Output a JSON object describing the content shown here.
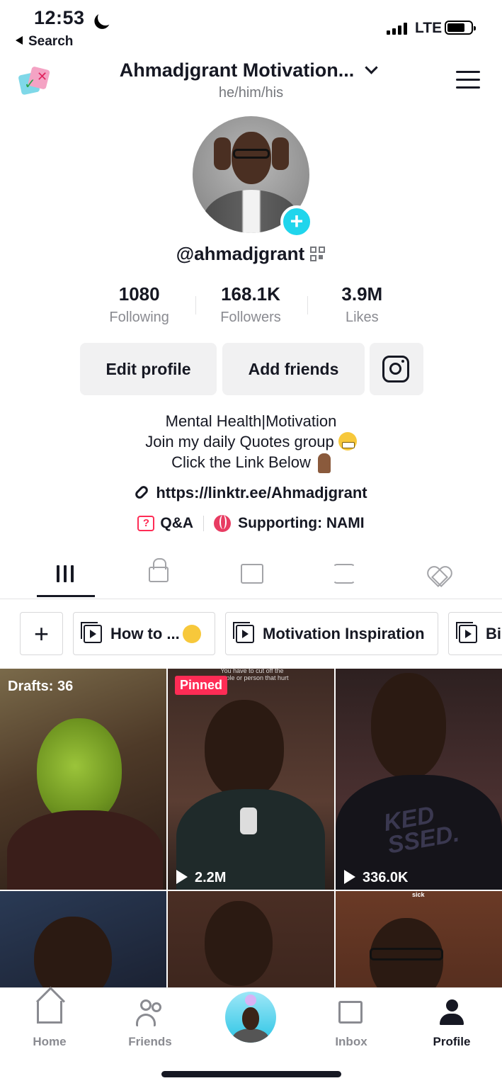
{
  "status": {
    "time": "12:53",
    "back_label": "Search",
    "network": "LTE",
    "battery_level": 0.75
  },
  "header": {
    "title": "Ahmadjgrant Motivation...",
    "pronouns": "he/him/his"
  },
  "profile": {
    "username": "@ahmadjgrant",
    "stats": [
      {
        "value": "1080",
        "label": "Following"
      },
      {
        "value": "168.1K",
        "label": "Followers"
      },
      {
        "value": "3.9M",
        "label": "Likes"
      }
    ],
    "buttons": {
      "edit": "Edit profile",
      "add_friends": "Add friends"
    },
    "bio": {
      "line1": "Mental Health|Motivation",
      "line2": "Join my daily Quotes group",
      "line3": "Click the Link Below"
    },
    "link": "https://linktr.ee/Ahmadjgrant",
    "qa_label": "Q&A",
    "supporting": "Supporting: NAMI"
  },
  "collections": [
    {
      "label": "How to ..."
    },
    {
      "label": "Motivation Inspiration"
    },
    {
      "label": "Bi"
    }
  ],
  "videos": {
    "drafts": "Drafts: 36",
    "pinned_badge": "Pinned",
    "pinned_views": "2.2M",
    "third_views": "336.0K",
    "caption_2": "You have to cut off the people or person that hurt",
    "shirt_text": "KED SSED.",
    "caption_6": "sick"
  },
  "nav": {
    "home": "Home",
    "friends": "Friends",
    "inbox": "Inbox",
    "profile": "Profile"
  },
  "colors": {
    "accent_cyan": "#20d5ec",
    "pinned_red": "#fe2c55",
    "text_primary": "#161823",
    "text_secondary": "#8a8b91"
  }
}
